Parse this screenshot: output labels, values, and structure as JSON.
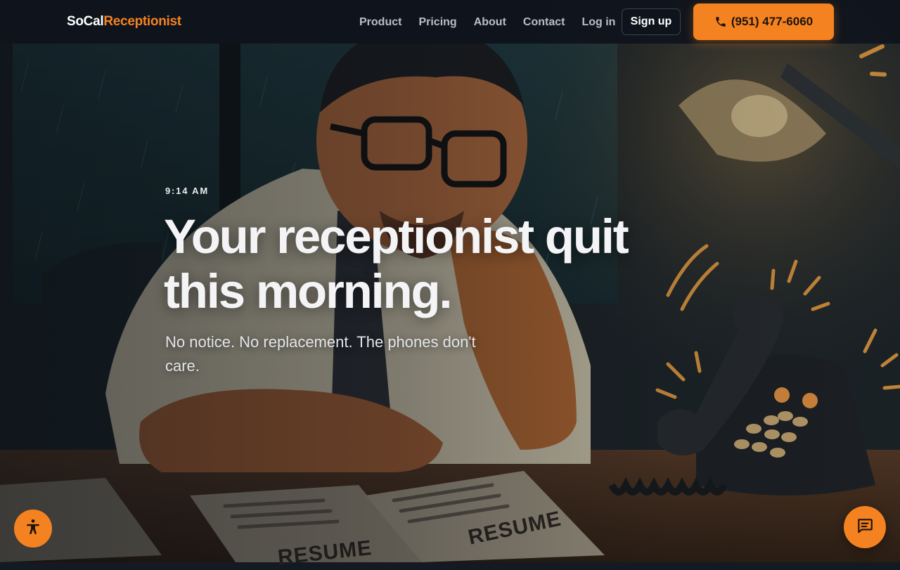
{
  "brand": {
    "name_part1": "SoCal",
    "name_part2": "Receptionist",
    "accent_color": "#f58220"
  },
  "nav": {
    "links": [
      {
        "label": "Product"
      },
      {
        "label": "Pricing"
      },
      {
        "label": "About"
      },
      {
        "label": "Contact"
      },
      {
        "label": "Log in"
      }
    ],
    "signup_label": "Sign up",
    "phone_label": "(951) 477-6060",
    "phone_icon": "phone-icon"
  },
  "hero": {
    "eyebrow": "9:14 AM",
    "headline_line1": "Your receptionist quit",
    "headline_line2": "this morning.",
    "subheadline": "No notice. No replacement. The phones don't care.",
    "illustration_text": "RESUME"
  },
  "floating": {
    "accessibility_icon": "accessibility-icon",
    "chat_icon": "chat-bubble-icon"
  }
}
